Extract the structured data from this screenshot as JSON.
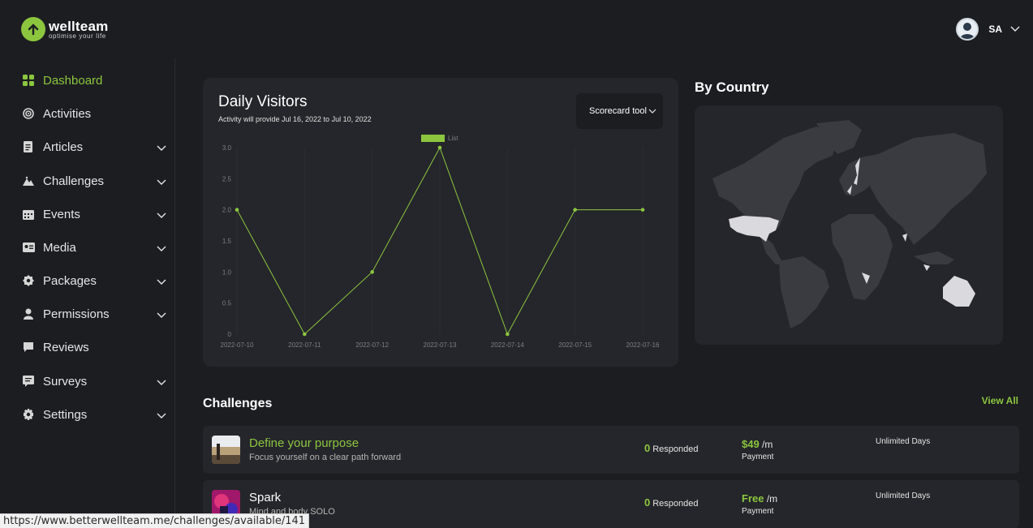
{
  "brand": {
    "name": "wellteam",
    "tagline": "optimise your life"
  },
  "user": {
    "initials": "SA"
  },
  "sidebar": {
    "items": [
      {
        "label": "Dashboard",
        "icon": "grid-icon",
        "active": true,
        "expandable": false
      },
      {
        "label": "Activities",
        "icon": "target-icon",
        "active": false,
        "expandable": false
      },
      {
        "label": "Articles",
        "icon": "document-icon",
        "active": false,
        "expandable": true
      },
      {
        "label": "Challenges",
        "icon": "mountain-icon",
        "active": false,
        "expandable": true
      },
      {
        "label": "Events",
        "icon": "calendar-icon",
        "active": false,
        "expandable": true
      },
      {
        "label": "Media",
        "icon": "id-card-icon",
        "active": false,
        "expandable": true
      },
      {
        "label": "Packages",
        "icon": "badge-icon",
        "active": false,
        "expandable": true
      },
      {
        "label": "Permissions",
        "icon": "person-icon",
        "active": false,
        "expandable": true
      },
      {
        "label": "Reviews",
        "icon": "comment-icon",
        "active": false,
        "expandable": false
      },
      {
        "label": "Surveys",
        "icon": "survey-icon",
        "active": false,
        "expandable": true
      },
      {
        "label": "Settings",
        "icon": "gear-icon",
        "active": false,
        "expandable": true
      }
    ]
  },
  "visitors": {
    "title": "Daily Visitors",
    "subtitle": "Activity will provide Jul 16, 2022 to Jul 10, 2022",
    "dropdown": "Scorecard tool"
  },
  "chart_data": {
    "type": "line",
    "x": [
      "2022-07-10",
      "2022-07-11",
      "2022-07-12",
      "2022-07-13",
      "2022-07-14",
      "2022-07-15",
      "2022-07-16"
    ],
    "series": [
      {
        "name": "List",
        "values": [
          2,
          0,
          1,
          3,
          0,
          2,
          2
        ]
      }
    ],
    "yticks": [
      "0",
      "0.5",
      "1.0",
      "1.5",
      "2.0",
      "2.5",
      "3.0"
    ],
    "ylim": [
      0,
      3
    ],
    "legend": "top-center",
    "color": "#8cc63f"
  },
  "country": {
    "title": "By Country"
  },
  "challenges": {
    "title": "Challenges",
    "view_all": "View All",
    "rows": [
      {
        "title": "Define your purpose",
        "subtitle": "Focus yourself on a clear path forward",
        "responded_count": "0",
        "responded_label": "Responded",
        "price": "$49",
        "period": "/m",
        "price_label": "Payment",
        "duration": "Unlimited Days",
        "highlight": true
      },
      {
        "title": "Spark",
        "subtitle": "Mind and body SOLO",
        "responded_count": "0",
        "responded_label": "Responded",
        "price": "Free",
        "period": "/m",
        "price_label": "Payment",
        "duration": "Unlimited Days",
        "highlight": false
      }
    ]
  },
  "status_url": "https://www.betterwellteam.me/challenges/available/141",
  "colors": {
    "accent": "#8cc63f",
    "background": "#1c1d21",
    "card": "#25262b"
  }
}
